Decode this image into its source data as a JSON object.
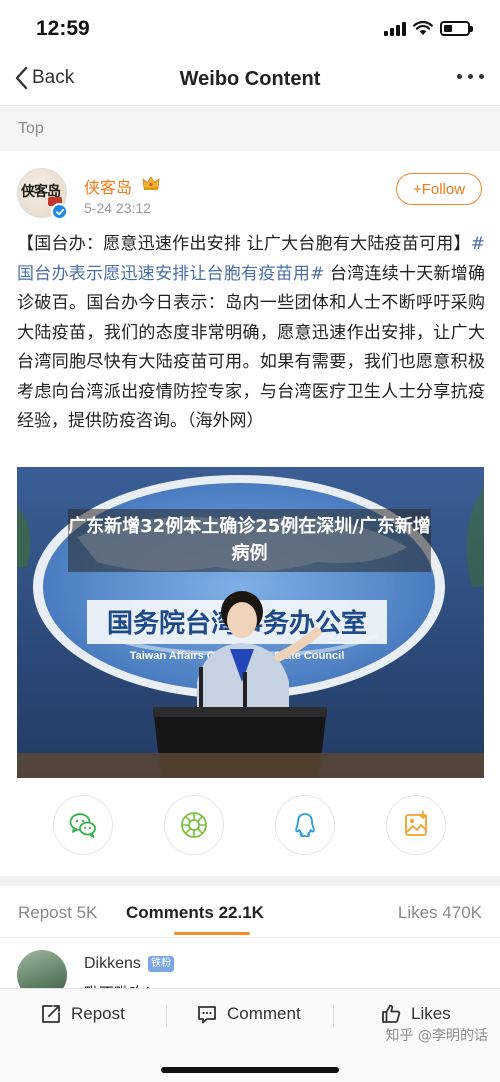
{
  "status_bar": {
    "time": "12:59"
  },
  "nav": {
    "back_label": "Back",
    "title": "Weibo Content"
  },
  "top_label": "Top",
  "post": {
    "author": "侠客岛",
    "avatar_text": "侠客岛",
    "time": "5-24 23:12",
    "follow_label": "+Follow",
    "text_before": "【国台办：愿意迅速作出安排 让广大台胞有大陆疫苗可用】",
    "topic": "#国台办表示愿迅速安排让台胞有疫苗用#",
    "text_after": " 台湾连续十天新增确诊破百。国台办今日表示：岛内一些团体和人士不断呼吁采购大陆疫苗，我们的态度非常明确，愿意迅速作出安排，让广大台湾同胞尽快有大陆疫苗可用。如果有需要，我们也愿意积极考虑向台湾派出疫情防控专家，与台湾医疗卫生人士分享抗疫经验，提供防疫咨询。（海外网）",
    "image": {
      "sign_cn": "国务院台湾事务办公室",
      "sign_en": "Taiwan Affairs Office of the State Council"
    },
    "overlay_title": "广东新增32例本土确诊25例在深圳/广东新增病例"
  },
  "share_icons": [
    "wechat-icon",
    "moments-icon",
    "qq-icon",
    "save-image-icon"
  ],
  "tabs": {
    "repost": "Repost 5K",
    "comments": "Comments 22.1K",
    "likes": "Likes 470K"
  },
  "comment": {
    "name": "Dikkens",
    "badge": "铁粉",
    "peek": "毗不毗咋！"
  },
  "bottom_bar": {
    "repost": "Repost",
    "comment": "Comment",
    "likes": "Likes"
  },
  "watermark": "知乎 @李明的话",
  "colors": {
    "accent": "#f07a17",
    "topic_link": "#4a6fa8",
    "verified": "#1e88e5"
  }
}
